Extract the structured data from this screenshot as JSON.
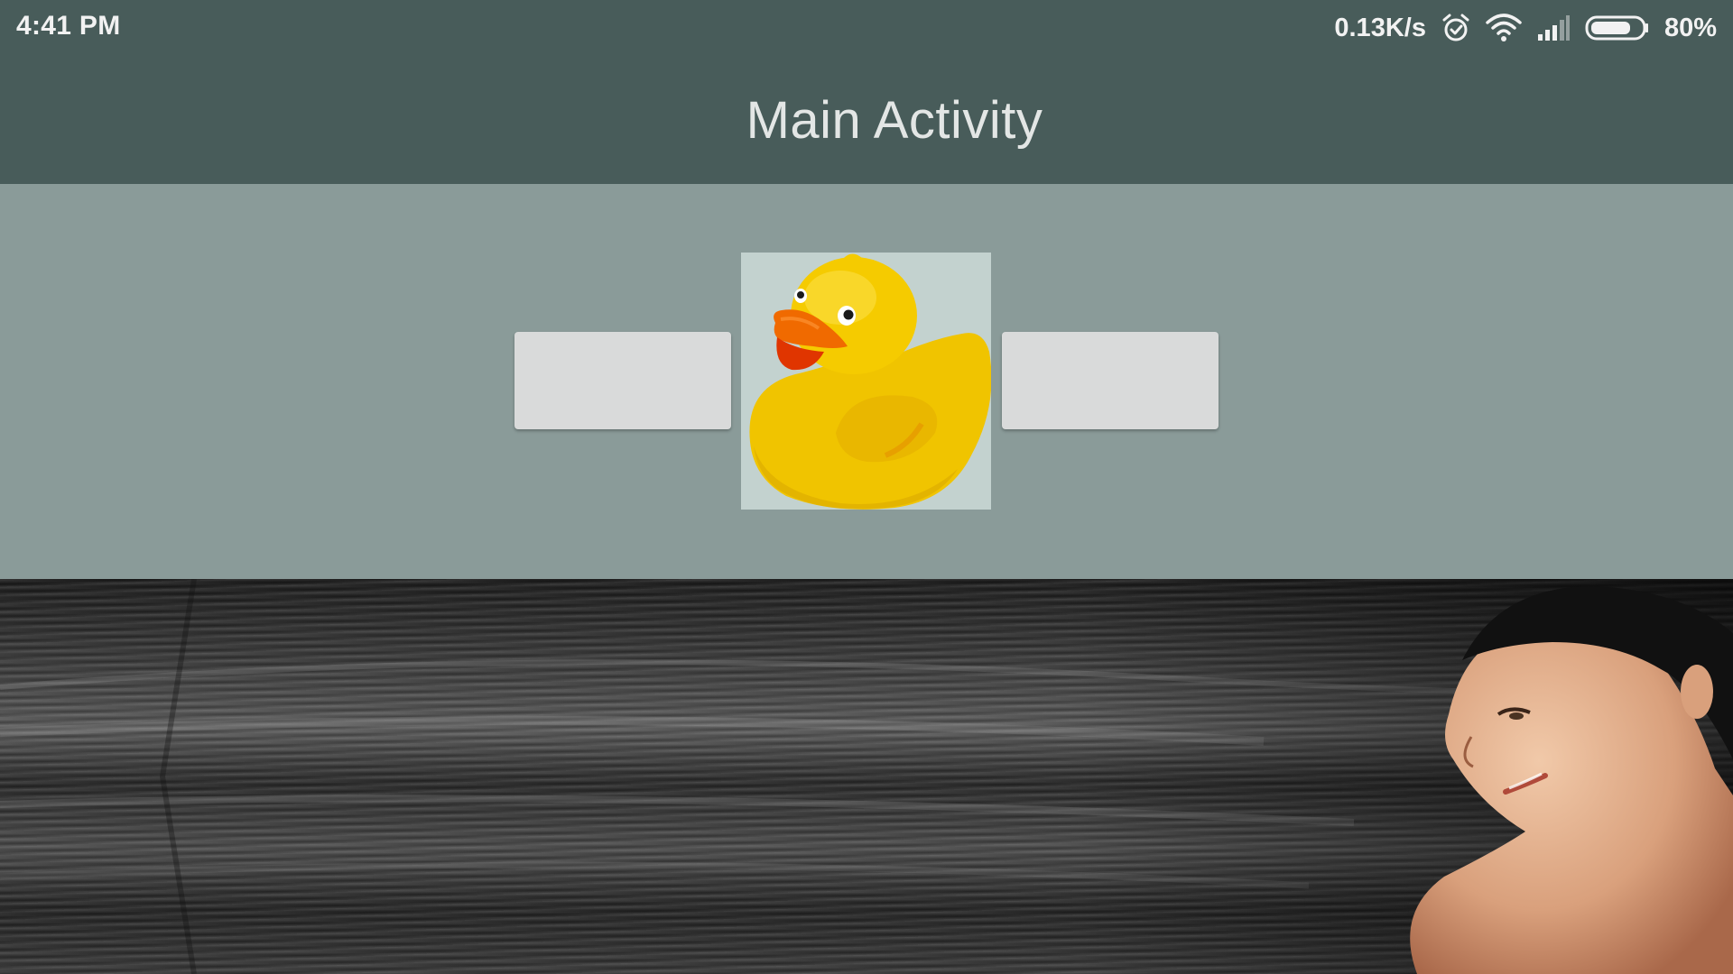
{
  "status_bar": {
    "time": "4:41 PM",
    "network_speed": "0.13K/s",
    "battery_percent": "80%",
    "battery_level": 0.8,
    "icons": [
      "alarm-icon",
      "wifi-icon",
      "signal-icon",
      "battery-icon"
    ]
  },
  "action_bar": {
    "title": "Main Activity"
  },
  "content": {
    "left_button_label": "",
    "right_button_label": "",
    "image": "rubber-duck"
  },
  "banner": {
    "image": "long-dark-hair-woman"
  },
  "colors": {
    "bar_background": "#485c5a",
    "content_background": "#8a9b99",
    "button_background": "#d9dada",
    "title_text": "#e3e6e5"
  }
}
